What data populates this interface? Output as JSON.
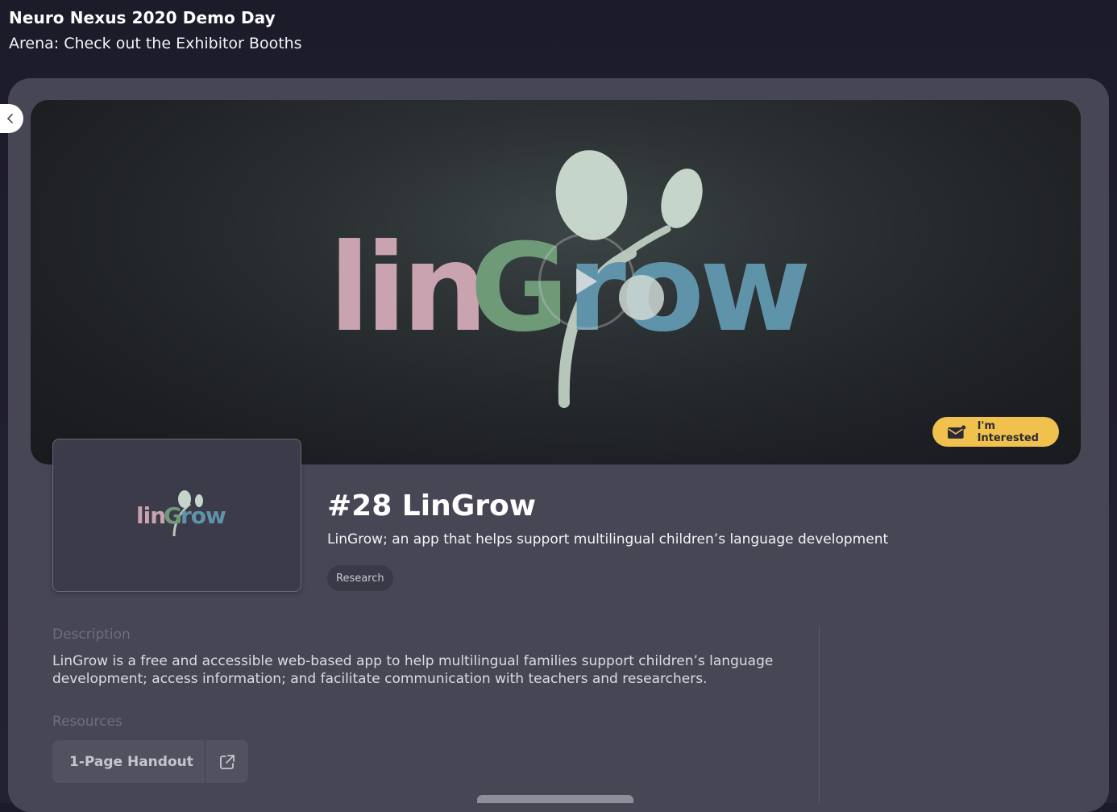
{
  "header": {
    "event_title": "Neuro Nexus 2020 Demo Day",
    "subtitle": "Arena: Check out the Exhibitor Booths"
  },
  "nav": {
    "back_icon": "chevron-left-icon"
  },
  "hero": {
    "logo_text": "linGrow",
    "play_icon": "play-icon",
    "interested_label": "I'm Interested",
    "interested_icon": "envelope-icon",
    "accent_color": "#f0c14d"
  },
  "booth": {
    "number_title": "#28 LinGrow",
    "tagline": "LinGrow; an app that helps support multilingual children’s language development",
    "tag": "Research",
    "thumbnail_logo_text": "linGrow"
  },
  "description": {
    "label": "Description",
    "text": "LinGrow is a free and accessible web-based app to help multilingual families support children’s language development; access information; and facilitate communication with teachers and researchers."
  },
  "resources": {
    "label": "Resources",
    "items": [
      {
        "label": "1-Page Handout",
        "icon": "external-link-icon"
      }
    ]
  },
  "brand_colors": {
    "lin": "#caa3b0",
    "g": "#6e9a78",
    "row": "#5f93a9",
    "sprout": "#c6d5c9"
  }
}
